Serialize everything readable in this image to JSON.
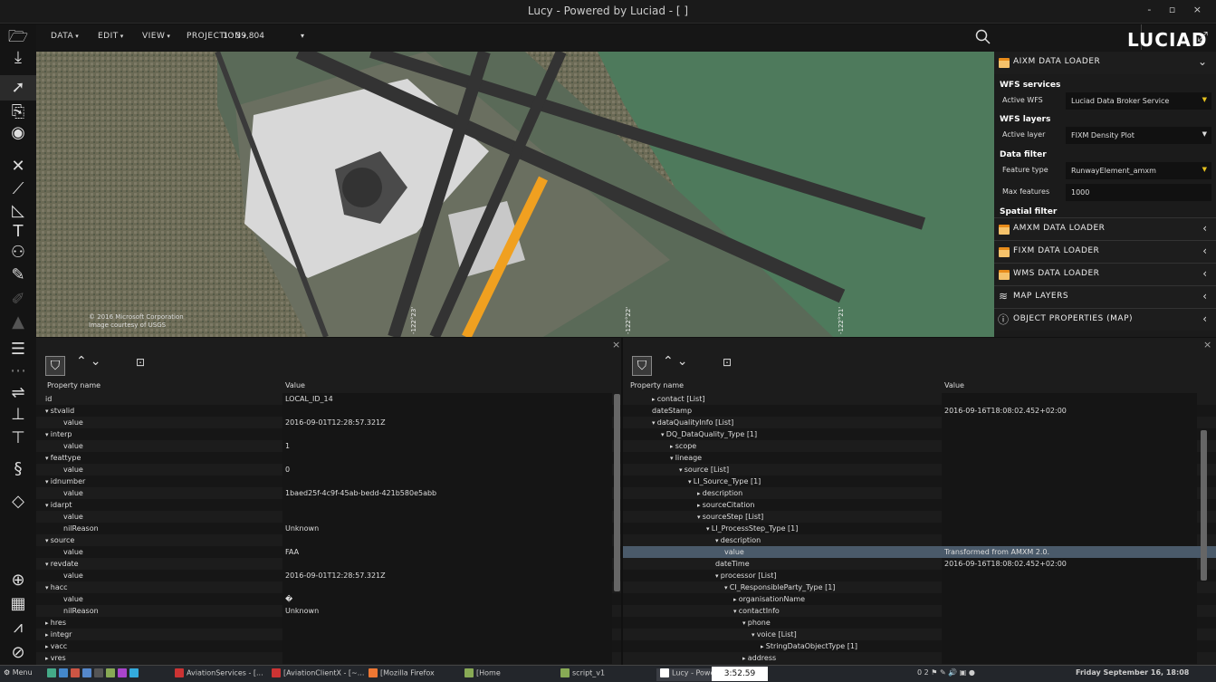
{
  "window": {
    "title": "Lucy - Powered by Luciad - [ ]",
    "controls": "- ▫ ×"
  },
  "toolbar": {
    "menus": [
      "DATA",
      "EDIT",
      "VIEW",
      "PROJECTION"
    ],
    "scale": "1 : 39,804",
    "logo": "LUCIAD"
  },
  "map": {
    "credit_line1": "© 2016 Microsoft Corporation",
    "credit_line2": "Image courtesy of USGS",
    "coord_labels": [
      "-122°23'",
      "-122°22'",
      "-122°21'"
    ]
  },
  "right_panel": {
    "aixm_title": "AIXM DATA LOADER",
    "wfs_services_heading": "WFS services",
    "active_wfs_label": "Active WFS",
    "active_wfs_value": "Luciad Data Broker Service",
    "wfs_layers_heading": "WFS layers",
    "active_layer_label": "Active layer",
    "active_layer_value": "FIXM Density Plot",
    "data_filter_heading": "Data filter",
    "feature_type_label": "Feature type",
    "feature_type_value": "RunwayElement_amxm",
    "max_features_label": "Max features",
    "max_features_value": "1000",
    "spatial_filter_heading": "Spatial filter",
    "amxm_title": "AMXM DATA LOADER",
    "fixm_title": "FIXM DATA LOADER",
    "wms_title": "WMS DATA LOADER",
    "map_layers_title": "MAP LAYERS",
    "object_props_title": "OBJECT PROPERTIES (MAP)"
  },
  "left_table": {
    "col_name": "Property name",
    "col_value": "Value",
    "rows": [
      {
        "name": "id",
        "indent": 0,
        "tri": "",
        "value": "LOCAL_ID_14"
      },
      {
        "name": "stvalid",
        "indent": 0,
        "tri": "▾",
        "value": ""
      },
      {
        "name": "value",
        "indent": 2,
        "tri": "",
        "value": "2016-09-01T12:28:57.321Z"
      },
      {
        "name": "interp",
        "indent": 0,
        "tri": "▾",
        "value": ""
      },
      {
        "name": "value",
        "indent": 2,
        "tri": "",
        "value": "1"
      },
      {
        "name": "feattype",
        "indent": 0,
        "tri": "▾",
        "value": ""
      },
      {
        "name": "value",
        "indent": 2,
        "tri": "",
        "value": "0"
      },
      {
        "name": "idnumber",
        "indent": 0,
        "tri": "▾",
        "value": ""
      },
      {
        "name": "value",
        "indent": 2,
        "tri": "",
        "value": "1baed25f-4c9f-45ab-bedd-421b580e5abb"
      },
      {
        "name": "idarpt",
        "indent": 0,
        "tri": "▾",
        "value": ""
      },
      {
        "name": "value",
        "indent": 2,
        "tri": "",
        "value": ""
      },
      {
        "name": "nilReason",
        "indent": 2,
        "tri": "",
        "value": "Unknown"
      },
      {
        "name": "source",
        "indent": 0,
        "tri": "▾",
        "value": ""
      },
      {
        "name": "value",
        "indent": 2,
        "tri": "",
        "value": "FAA"
      },
      {
        "name": "revdate",
        "indent": 0,
        "tri": "▾",
        "value": ""
      },
      {
        "name": "value",
        "indent": 2,
        "tri": "",
        "value": "2016-09-01T12:28:57.321Z"
      },
      {
        "name": "hacc",
        "indent": 0,
        "tri": "▾",
        "value": ""
      },
      {
        "name": "value",
        "indent": 2,
        "tri": "",
        "value": "�"
      },
      {
        "name": "nilReason",
        "indent": 2,
        "tri": "",
        "value": "Unknown"
      },
      {
        "name": "hres",
        "indent": 0,
        "tri": "▸",
        "value": ""
      },
      {
        "name": "integr",
        "indent": 0,
        "tri": "▸",
        "value": ""
      },
      {
        "name": "vacc",
        "indent": 0,
        "tri": "▸",
        "value": ""
      },
      {
        "name": "vres",
        "indent": 0,
        "tri": "▸",
        "value": ""
      }
    ]
  },
  "right_table": {
    "col_name": "Property name",
    "col_value": "Value",
    "rows": [
      {
        "name": "contact [List]",
        "indent": 1,
        "tri": "▸",
        "value": ""
      },
      {
        "name": "dateStamp",
        "indent": 1,
        "tri": "",
        "value": "2016-09-16T18:08:02.452+02:00"
      },
      {
        "name": "dataQualityInfo [List]",
        "indent": 1,
        "tri": "▾",
        "value": ""
      },
      {
        "name": "DQ_DataQuality_Type [1]",
        "indent": 2,
        "tri": "▾",
        "value": ""
      },
      {
        "name": "scope",
        "indent": 3,
        "tri": "▸",
        "value": ""
      },
      {
        "name": "lineage",
        "indent": 3,
        "tri": "▾",
        "value": ""
      },
      {
        "name": "source [List]",
        "indent": 4,
        "tri": "▾",
        "value": ""
      },
      {
        "name": "LI_Source_Type [1]",
        "indent": 5,
        "tri": "▾",
        "value": ""
      },
      {
        "name": "description",
        "indent": 6,
        "tri": "▸",
        "value": ""
      },
      {
        "name": "sourceCitation",
        "indent": 6,
        "tri": "▸",
        "value": ""
      },
      {
        "name": "sourceStep [List]",
        "indent": 6,
        "tri": "▾",
        "value": ""
      },
      {
        "name": "LI_ProcessStep_Type [1]",
        "indent": 7,
        "tri": "▾",
        "value": ""
      },
      {
        "name": "description",
        "indent": 8,
        "tri": "▾",
        "value": ""
      },
      {
        "name": "value",
        "indent": 9,
        "tri": "",
        "value": "Transformed from AMXM 2.0."
      },
      {
        "name": "dateTime",
        "indent": 8,
        "tri": "",
        "value": "2016-09-16T18:08:02.452+02:00"
      },
      {
        "name": "processor [List]",
        "indent": 8,
        "tri": "▾",
        "value": ""
      },
      {
        "name": "CI_ResponsibleParty_Type [1]",
        "indent": 9,
        "tri": "▾",
        "value": ""
      },
      {
        "name": "organisationName",
        "indent": 10,
        "tri": "▸",
        "value": ""
      },
      {
        "name": "contactInfo",
        "indent": 10,
        "tri": "▾",
        "value": ""
      },
      {
        "name": "phone",
        "indent": 11,
        "tri": "▾",
        "value": ""
      },
      {
        "name": "voice [List]",
        "indent": 12,
        "tri": "▾",
        "value": ""
      },
      {
        "name": "StringDataObjectType [1]",
        "indent": 13,
        "tri": "▸",
        "value": ""
      },
      {
        "name": "address",
        "indent": 11,
        "tri": "▸",
        "value": ""
      }
    ],
    "highlight_index": 13
  },
  "taskbar": {
    "menu": "Menu",
    "apps": [
      "AviationServices - [...",
      "[AviationClientX - [~...",
      "[Mozilla Firefox",
      "[Home",
      "script_v1",
      "Lucy - Powe"
    ],
    "clock_overlay": "3:52.59",
    "status_icons": "0 2",
    "datetime": "Friday September 16, 18:08"
  },
  "colors": {
    "accent_yellow": "#e6c21f",
    "runway_highlight": "#f0a020",
    "water": "#4e7a5c",
    "highlight_row": "#4a5a6a"
  }
}
